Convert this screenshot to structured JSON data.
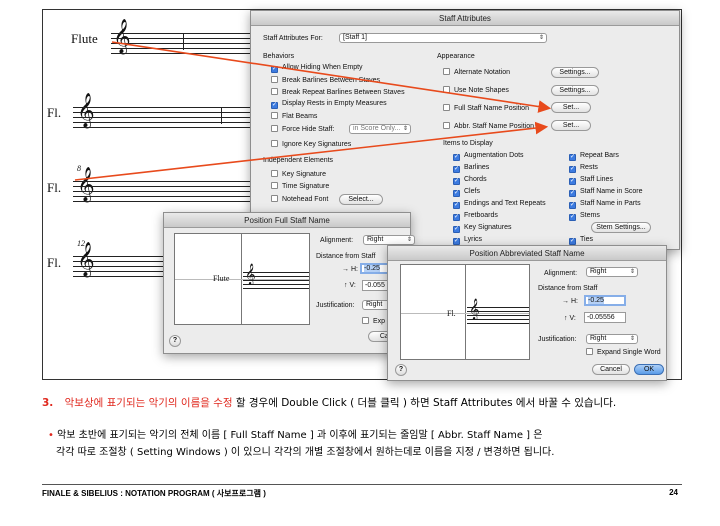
{
  "score": {
    "staves": [
      {
        "label": "Flute",
        "measure": ""
      },
      {
        "label": "Fl.",
        "measure": ""
      },
      {
        "label": "Fl.",
        "measure": "8"
      },
      {
        "label": "Fl.",
        "measure": "12"
      }
    ]
  },
  "staff_attributes": {
    "title": "Staff Attributes",
    "for_label": "Staff Attributes For:",
    "for_value": "[Staff 1]",
    "behaviors_title": "Behaviors",
    "behaviors": [
      {
        "label": "Allow Hiding When Empty",
        "checked": true
      },
      {
        "label": "Break Barlines Between Staves",
        "checked": false
      },
      {
        "label": "Break Repeat Barlines Between Staves",
        "checked": false
      },
      {
        "label": "Display Rests in Empty Measures",
        "checked": true
      },
      {
        "label": "Flat Beams",
        "checked": false
      },
      {
        "label": "Force Hide Staff:",
        "checked": false
      },
      {
        "label": "Ignore Key Signatures",
        "checked": false
      }
    ],
    "force_hide_value": "in Score Only...",
    "independent_title": "Independent Elements",
    "independent": [
      {
        "label": "Key Signature",
        "checked": false
      },
      {
        "label": "Time Signature",
        "checked": false
      },
      {
        "label": "Notehead Font",
        "checked": false
      }
    ],
    "select_label": "Select...",
    "appearance_title": "Appearance",
    "appearance": [
      {
        "label": "Alternate Notation",
        "button": "Settings..."
      },
      {
        "label": "Use Note Shapes",
        "button": "Settings..."
      },
      {
        "label": "Full Staff Name Position",
        "button": "Set..."
      },
      {
        "label": "Abbr. Staff Name Position",
        "button": "Set..."
      }
    ],
    "items_title": "Items to Display",
    "items_left": [
      "Augmentation Dots",
      "Barlines",
      "Chords",
      "Clefs",
      "Endings and Text Repeats",
      "Fretboards",
      "Key Signatures",
      "Lyrics"
    ],
    "items_right": [
      "Repeat Bars",
      "Rests",
      "Staff Lines",
      "Staff Name in Score",
      "Staff Name in Parts",
      "Stems",
      "",
      "Ties"
    ],
    "stem_settings": "Stem Settings..."
  },
  "full_dialog": {
    "title": "Position Full Staff Name",
    "preview_name": "Flute",
    "alignment_label": "Alignment:",
    "alignment_value": "Right",
    "distance_label": "Distance from Staff",
    "h_label": "→ H:",
    "h_value": "-0.25",
    "v_label": "↑ V:",
    "v_value": "-0.055",
    "justification_label": "Justification:",
    "justification_value": "Right",
    "expand_label": "Exp",
    "cancel": "Canc"
  },
  "abbr_dialog": {
    "title": "Position Abbreviated Staff Name",
    "preview_name": "Fl.",
    "alignment_label": "Alignment:",
    "alignment_value": "Right",
    "distance_label": "Distance from Staff",
    "h_label": "→ H:",
    "h_value": "-0.25",
    "v_label": "↑ V:",
    "v_value": "-0.05556",
    "justification_label": "Justification:",
    "justification_value": "Right",
    "expand_label": "Expand Single Word",
    "cancel": "Cancel",
    "ok": "OK"
  },
  "caption": {
    "num": "3.",
    "line1_red": "악보상에 표기되는 악기의 이름을 수정",
    "line1_rest": " 할 경우에 Double Click ( 더블 클릭 ) 하면 Staff Attributes 에서 바꿀 수 있습니다.",
    "bullet": "•",
    "line2": "악보 초반에 표기되는 악기의 전체 이름 [ Full Staff Name ] 과 이후에 표기되는 줄임말 [ Abbr. Staff Name ] 은",
    "line3": "각각 따로 조절창 ( Setting Windows ) 이 있으니 각각의 개별 조절창에서 원하는데로 이름을 지정 / 변경하면 됩니다."
  },
  "footer": {
    "left": "FINALE & SIBELIUS : NOTATION PROGRAM ( 사보프로그램 )",
    "page": "24"
  },
  "colors": {
    "arrow": "#e84a1c",
    "accent": "#e0281e",
    "check": "#3d7be0"
  }
}
